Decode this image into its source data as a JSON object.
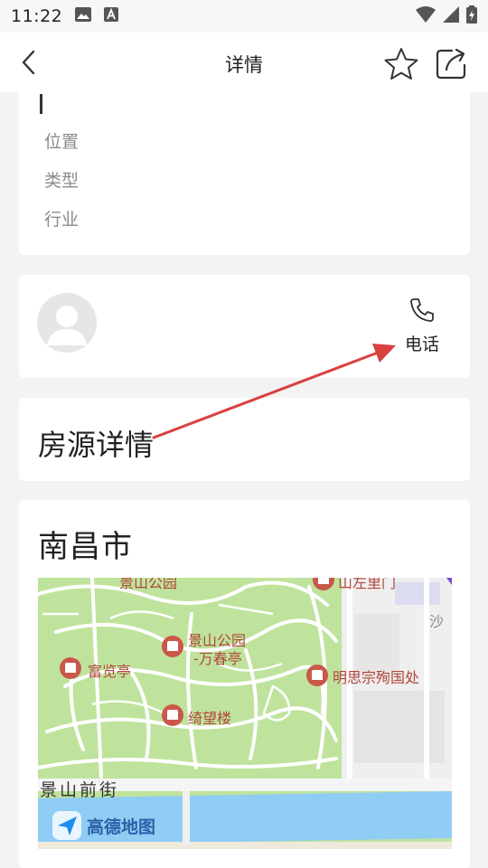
{
  "status_bar": {
    "time": "11:22"
  },
  "nav": {
    "title": "详情"
  },
  "info_card": {
    "rows": [
      "位置",
      "类型",
      "行业"
    ]
  },
  "contact_card": {
    "phone_label": "电话"
  },
  "listing_card": {
    "heading": "房源详情"
  },
  "location_card": {
    "city": "南昌市"
  },
  "map": {
    "pois": [
      {
        "name": "景山公园"
      },
      {
        "name": "富览亭"
      },
      {
        "name": "景山公园"
      },
      {
        "name": "-万春亭"
      },
      {
        "name": "明思宗殉国处"
      },
      {
        "name": "绮望楼"
      },
      {
        "name": "山左里门"
      },
      {
        "name": "沙"
      }
    ],
    "street": "景山前街",
    "provider": "高德地图"
  },
  "colors": {
    "accent_arrow": "#d94040",
    "park_green": "#bfe39c",
    "water_blue": "#8fcdf5",
    "poi_red": "#c9584a"
  }
}
